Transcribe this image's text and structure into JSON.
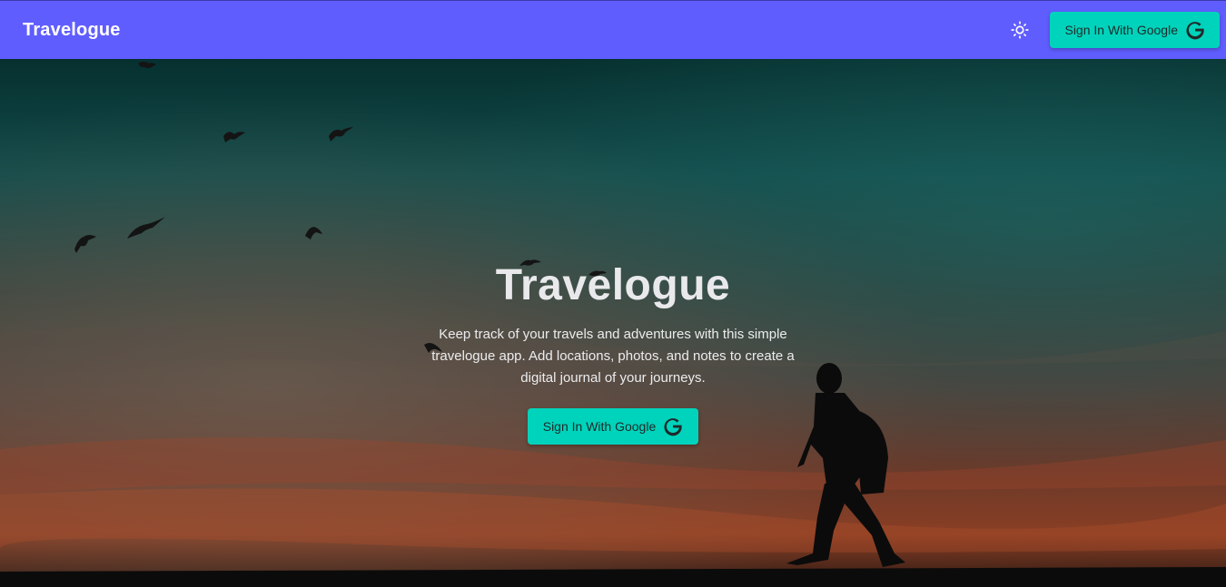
{
  "navbar": {
    "brand": "Travelogue",
    "theme_icon": "sun-icon",
    "signin_label": "Sign In With Google",
    "signin_icon": "google-g-icon"
  },
  "hero": {
    "title": "Travelogue",
    "description": "Keep track of your travels and adventures with this simple travelogue app. Add locations, photos, and notes to create a digital journal of your journeys.",
    "signin_label": "Sign In With Google",
    "signin_icon": "google-g-icon",
    "background": "sunset-sky-with-birds-and-hiker-silhouette"
  },
  "colors": {
    "navbar_bg": "#605dff",
    "button_bg": "#00d3bb",
    "button_text": "#1f2a2a",
    "brand_text": "#ffffff"
  }
}
